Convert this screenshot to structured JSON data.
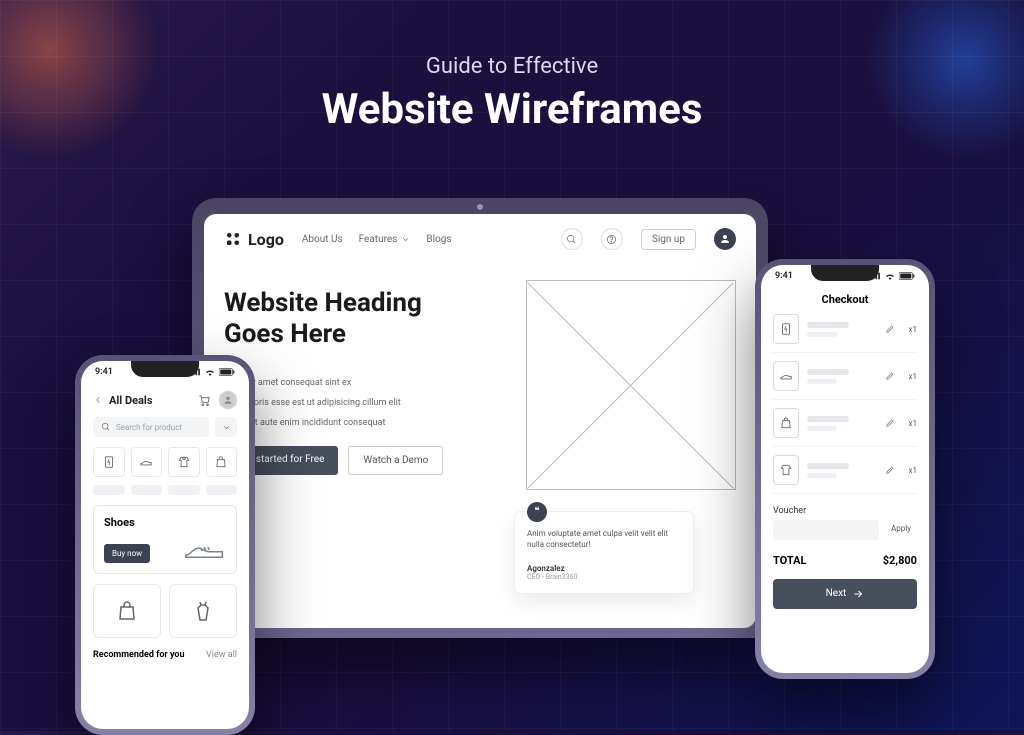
{
  "headline": {
    "subtitle": "Guide to Effective",
    "title": "Website Wireframes"
  },
  "laptop": {
    "logo": "Logo",
    "nav": {
      "about": "About Us",
      "features": "Features",
      "blogs": "Blogs"
    },
    "signup": "Sign up",
    "heading": "Website Heading\nGoes Here",
    "bullets": [
      "Pariatur amet consequat sint ex",
      "Sint laboris esse est ut adipisicing cillum elit",
      "Proident aute enim incididunt consequat"
    ],
    "cta_primary": "Get started for Free",
    "cta_secondary": "Watch a Demo",
    "testimonial": {
      "text": "Anim voluptate amet culpa velit velit elit nulla consectetur!",
      "name": "Agonzalez",
      "role": "CEO - Brain3360"
    }
  },
  "mobile_left": {
    "time": "9:41",
    "title": "All Deals",
    "search_placeholder": "Search for product",
    "card_title": "Shoes",
    "buy_now": "Buy now",
    "section_title": "Recommended for you",
    "view_all": "View all"
  },
  "mobile_right": {
    "time": "9:41",
    "title": "Checkout",
    "qty": "x1",
    "voucher_label": "Voucher",
    "apply": "Apply",
    "total_label": "TOTAL",
    "total_value": "$2,800",
    "next": "Next"
  }
}
